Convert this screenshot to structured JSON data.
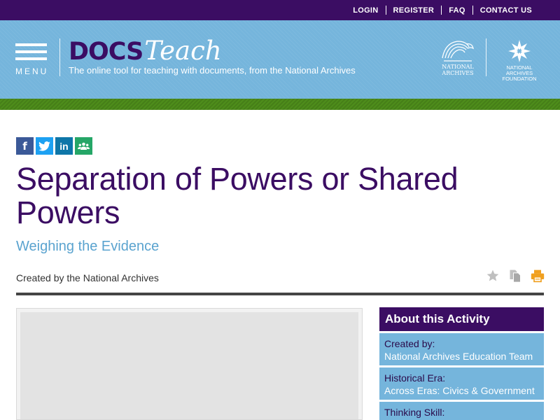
{
  "topnav": {
    "login": "LOGIN",
    "register": "REGISTER",
    "faq": "FAQ",
    "contact": "CONTACT US"
  },
  "header": {
    "menu_label": "MENU",
    "logo_docs": "DOCS",
    "logo_teach": "Teach",
    "tagline": "The online tool for teaching with documents, from the National Archives",
    "na_logo_text": "NATIONAL ARCHIVES",
    "naf_logo_text": "NATIONAL ARCHIVES FOUNDATION"
  },
  "social": {
    "facebook": "f",
    "twitter": "t",
    "linkedin": "in",
    "classroom": "classroom-icon"
  },
  "page": {
    "title": "Separation of Powers or Shared Powers",
    "subtitle": "Weighing the Evidence",
    "created_by": "Created by the National Archives"
  },
  "tools": [
    "star-icon",
    "copy-icon",
    "print-icon"
  ],
  "about": {
    "heading": "About this Activity",
    "rows": [
      {
        "key": "Created by:",
        "value": "National Archives Education Team"
      },
      {
        "key": "Historical Era:",
        "value": "Across Eras: Civics & Government"
      },
      {
        "key": "Thinking Skill:",
        "value": ""
      }
    ]
  },
  "colors": {
    "purple": "#3b0d63",
    "light_blue": "#75b5dc",
    "green": "#4e8d1b",
    "subtitle_blue": "#5aa3cf",
    "print_orange": "#f0a020"
  }
}
